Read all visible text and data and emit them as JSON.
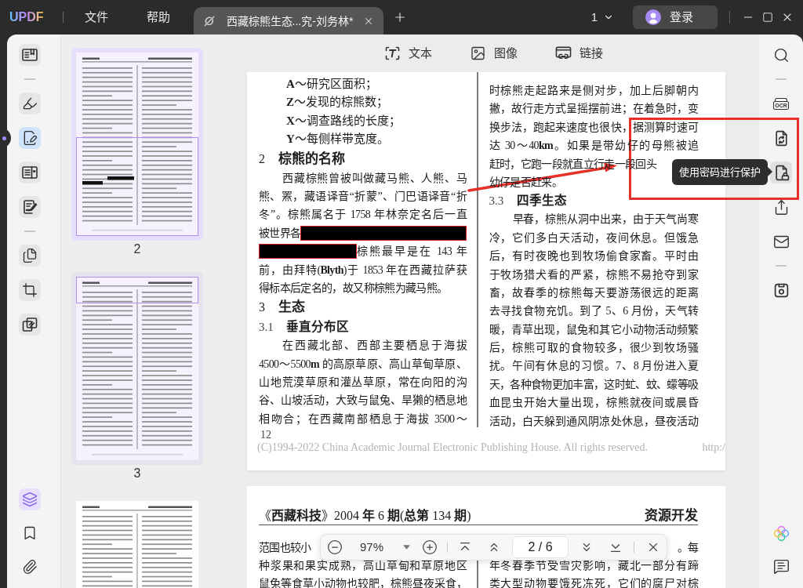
{
  "title_bar": {
    "logo": "UPDF",
    "menus": [
      "文件",
      "帮助"
    ],
    "tabs": [
      {
        "title": "西藏棕熊生态...究-刘务林*",
        "selected": true
      }
    ],
    "window_count": "1",
    "login": "登录"
  },
  "left_toolbar": {
    "tools": [
      {
        "kind": "reader",
        "selected": false
      },
      {
        "kind": "divider"
      },
      {
        "kind": "highlight",
        "selected": false
      },
      {
        "kind": "edit",
        "selected": true
      },
      {
        "kind": "form",
        "selected": false
      },
      {
        "kind": "sign",
        "selected": false
      },
      {
        "kind": "divider"
      },
      {
        "kind": "pages",
        "selected": false
      },
      {
        "kind": "crop",
        "selected": false
      },
      {
        "kind": "overlay",
        "selected": false
      }
    ],
    "panels": [
      {
        "kind": "layers",
        "selected": true
      },
      {
        "kind": "bookmark",
        "selected": false
      },
      {
        "kind": "attachment",
        "selected": false
      }
    ]
  },
  "thumbnails": [
    {
      "label": "2",
      "selected": true,
      "in_view": true,
      "view_top": false,
      "redacted": true
    },
    {
      "label": "3",
      "selected": false,
      "in_view": true,
      "view_top": true,
      "redacted": false
    },
    {
      "selected": false,
      "in_view": false
    }
  ],
  "viewer": {
    "tools": [
      {
        "kind": "text",
        "label": "文本"
      },
      {
        "kind": "image",
        "label": "图像"
      },
      {
        "kind": "link",
        "label": "链接"
      }
    ],
    "page_1": {
      "left_column": [
        {
          "kind": "formula",
          "text": "**A**～研究区面积；"
        },
        {
          "kind": "formula",
          "text": "**Z**～发现的棕熊数；"
        },
        {
          "kind": "formula",
          "text": "**X**～调查路线的长度；"
        },
        {
          "kind": "formula",
          "text": "**Y**～每侧样带宽度。"
        },
        {
          "kind": "section",
          "number": "2",
          "title": "棕熊的名称"
        },
        {
          "kind": "paragraph",
          "lines": [
            {
              "kind": "first",
              "text": "西藏棕熊曾被叫做藏马熊、人熊、马"
            },
            {
              "kind": "line",
              "text": "熊、罴，藏语译音“折蒙”、门巴语译音“折"
            },
            {
              "kind": "line",
              "text": "冬”。棕熊属名于 1758 年林奈定名后一直"
            },
            {
              "kind": "text_then_redaction",
              "text": "被世界各"
            },
            {
              "kind": "redaction_then_text",
              "text": "棕熊最早是在 143 年"
            },
            {
              "kind": "line",
              "text": "前，由拜特(**Blyth**)于 1853 年在西藏拉萨获"
            },
            {
              "kind": "short",
              "text": "得标本后定名的，故又称棕熊为藏马熊。"
            }
          ]
        },
        {
          "kind": "section",
          "number": "3",
          "title": "生态"
        },
        {
          "kind": "subsection",
          "number": "3.1",
          "title": "垂直分布区"
        },
        {
          "kind": "paragraph",
          "lines": [
            {
              "kind": "first",
              "text": "在西藏北部、西部主要栖息于海拔"
            },
            {
              "kind": "line",
              "text": "4500～5500**m** 的高原草原、高山草甸草原、"
            },
            {
              "kind": "line",
              "text": "山地荒漠草原和灌丛草原，常在向阳的沟"
            },
            {
              "kind": "line",
              "text": "谷、山坡活动，大致与鼠兔、旱獭的栖息地"
            },
            {
              "kind": "line",
              "text": "相吻合；在西藏南部栖息于海拔 3500～"
            }
          ]
        }
      ],
      "right_column": [
        {
          "kind": "paragraph",
          "lines": [
            {
              "kind": "line",
              "text": "时棕熊走起路来是侧对步，加上后脚朝内"
            },
            {
              "kind": "line",
              "text": "撇，故行走方式呈摇摆前进；在着急时，变"
            },
            {
              "kind": "line",
              "text": "换步法，跑起来速度也很快，据测算时速可"
            },
            {
              "kind": "line",
              "text": "达 30～40**km**。如果是带幼仔的母熊被追"
            },
            {
              "kind": "short",
              "text": "赶时，它跑一段就直立行走一段回头"
            },
            {
              "kind": "short",
              "text": "幼仔是否赶来。"
            }
          ]
        },
        {
          "kind": "subsection",
          "number": "3.3",
          "title": "四季生态"
        },
        {
          "kind": "paragraph",
          "lines": [
            {
              "kind": "first",
              "text": "早春，棕熊从洞中出来，由于天气尚寒"
            },
            {
              "kind": "line",
              "text": "冷，它们多白天活动，夜间休息。但饿急"
            },
            {
              "kind": "line",
              "text": "后，有时夜晚也到牧场偷食家畜。平时由"
            },
            {
              "kind": "line",
              "text": "于牧场猎犬看的严紧，棕熊不易抢夺到家"
            },
            {
              "kind": "line",
              "text": "畜，故春季的棕熊每天要游荡很远的距离"
            },
            {
              "kind": "line",
              "text": "去寻找食物充饥。到了 5、6 月份，天气转"
            },
            {
              "kind": "line",
              "text": "暖，青草出现，鼠兔和其它小动物活动频繁"
            },
            {
              "kind": "line",
              "text": "后，棕熊可取的食物较多，很少到牧场骚"
            },
            {
              "kind": "line",
              "text": "扰。午间有休息的习惯。7、8 月份进入夏"
            },
            {
              "kind": "line",
              "text": "天，各种食物更加丰富，这时虻、蚊、蠓等吸"
            },
            {
              "kind": "line",
              "text": "血昆虫开始大量出现，棕熊就夜间或晨昏"
            },
            {
              "kind": "line",
              "text": "活动，白天躲到通风阴凉处休息，昼夜活动"
            }
          ]
        }
      ],
      "page_number": "12",
      "footer": "(C)1994-2022 China Academic Journal Electronic Publishing House. All rights reserved.",
      "footer_link": "http:/"
    },
    "page_2": {
      "header_left": "《**西藏科技**》2004 **年** 6 **期**(**总第** 134 **期**)",
      "header_right": "资源开发",
      "left_column": [
        {
          "kind": "fragment_start",
          "text": "范围也较小"
        },
        {
          "kind": "line",
          "text": "种浆果和果实成熟，高山草甸和草原地区"
        },
        {
          "kind": "line",
          "text": "鼠兔等食草小动物也较肥，棕熊昼夜采食，"
        }
      ],
      "right_column": [
        {
          "kind": "fragment_end",
          "text": "。每"
        },
        {
          "kind": "line",
          "text": "年冬春季节受雪灾影响，藏北一部分有蹄"
        },
        {
          "kind": "line",
          "text": "类大型动物要饿死冻死，它们的腐尸对棕"
        }
      ]
    }
  },
  "right_sidebar": {
    "tools": [
      {
        "kind": "search",
        "active": false
      },
      {
        "kind": "divider"
      },
      {
        "kind": "ocr",
        "label": "OCR",
        "active": false
      },
      {
        "kind": "convert",
        "active": false
      },
      {
        "kind": "protect",
        "active": true
      },
      {
        "kind": "share",
        "active": false
      },
      {
        "kind": "email",
        "active": false
      },
      {
        "kind": "divider"
      },
      {
        "kind": "save",
        "active": false
      }
    ],
    "bottom": [
      {
        "kind": "ai"
      },
      {
        "kind": "comment"
      }
    ]
  },
  "tooltip": {
    "text": "使用密码进行保护"
  },
  "zoom_bar": {
    "zoom": "97%",
    "page": "2 / 6"
  },
  "annotations": {
    "frame": true,
    "arrow": true
  }
}
